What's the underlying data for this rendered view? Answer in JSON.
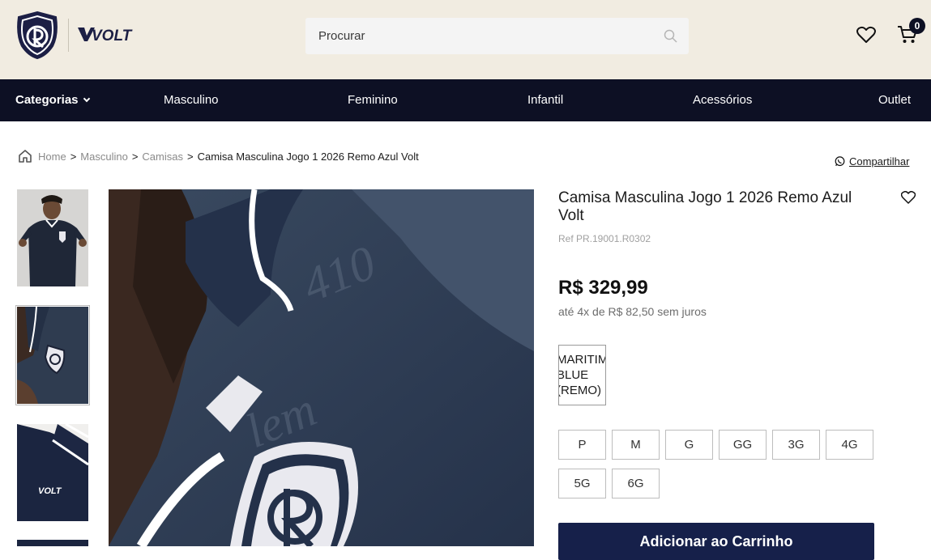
{
  "header": {
    "brand_logo": "remo-crest-logo",
    "sponsor_logo": "volt-logo",
    "sponsor_text": "VOLT",
    "search": {
      "placeholder": "Procurar",
      "icon": "search-icon"
    },
    "wishlist_icon": "heart-icon",
    "cart_icon": "cart-icon",
    "cart_count": "0"
  },
  "nav": {
    "categories_label": "Categorias",
    "items": [
      "Masculino",
      "Feminino",
      "Infantil",
      "Acessórios",
      "Outlet"
    ]
  },
  "breadcrumb": {
    "icon": "home-icon",
    "items": [
      "Home",
      "Masculino",
      "Camisas",
      "Camisa Masculina Jogo 1 2026 Remo Azul Volt"
    ],
    "separator": ">"
  },
  "share": {
    "label": "Compartilhar",
    "icon": "whatsapp-icon"
  },
  "product": {
    "title": "Camisa Masculina Jogo 1 2026 Remo Azul Volt",
    "ref": "Ref PR.19001.R0302",
    "price": "R$ 329,99",
    "installments": "até 4x de R$ 82,50 sem juros",
    "color_option": "MARITIME\nBLUE\n(REMO)",
    "sizes": [
      "P",
      "M",
      "G",
      "GG",
      "3G",
      "4G",
      "5G",
      "6G"
    ],
    "add_to_cart": "Adicionar ao Carrinho"
  },
  "colors": {
    "header_bg": "#f1ece1",
    "nav_bg": "#0d1024",
    "button_bg": "#16204a",
    "shirt_navy": "#303e52"
  }
}
